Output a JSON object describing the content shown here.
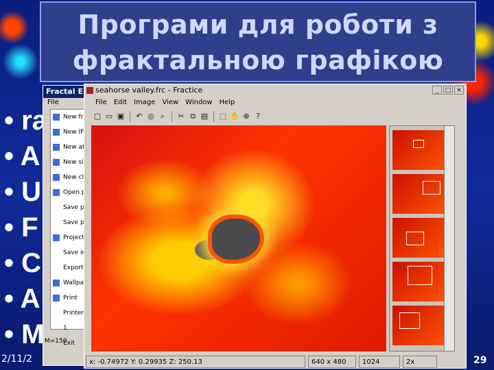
{
  "slide": {
    "title_line1": "Програми для роботи з",
    "title_line2": "фрактальною графікою",
    "bullets": [
      "• ra",
      "• A",
      "• U",
      "• F",
      "• C",
      "• A",
      "• M"
    ],
    "date": "2/11/2",
    "page_number": "29"
  },
  "back_window": {
    "title": "Fractal E",
    "menu": "File",
    "items": [
      "New fra",
      "New IF",
      "New at",
      "New si",
      "New cl",
      "Open p",
      "Save p",
      "Save p",
      "Project",
      "Save in",
      "Export",
      "Wallpa",
      "Print",
      "Printer",
      "1",
      "Exit"
    ],
    "status": "M=150"
  },
  "main_window": {
    "title": "seahorse valley.frc - Fractice",
    "menu": [
      "File",
      "Edit",
      "Image",
      "View",
      "Window",
      "Help"
    ],
    "toolbar_icons": [
      "new-icon",
      "open-icon",
      "save-icon",
      "undo-icon",
      "capture-icon",
      "zoom-icon",
      "copy-icon",
      "cut-icon",
      "paste-icon",
      "select-icon",
      "hand-icon",
      "zoom-in-icon",
      "help-icon"
    ],
    "status": {
      "coords": "x: -0.74972  Y: 0.29935  Z: 250.13",
      "size": "640 x 480",
      "resolution": "1024",
      "zoom": "2x"
    }
  }
}
